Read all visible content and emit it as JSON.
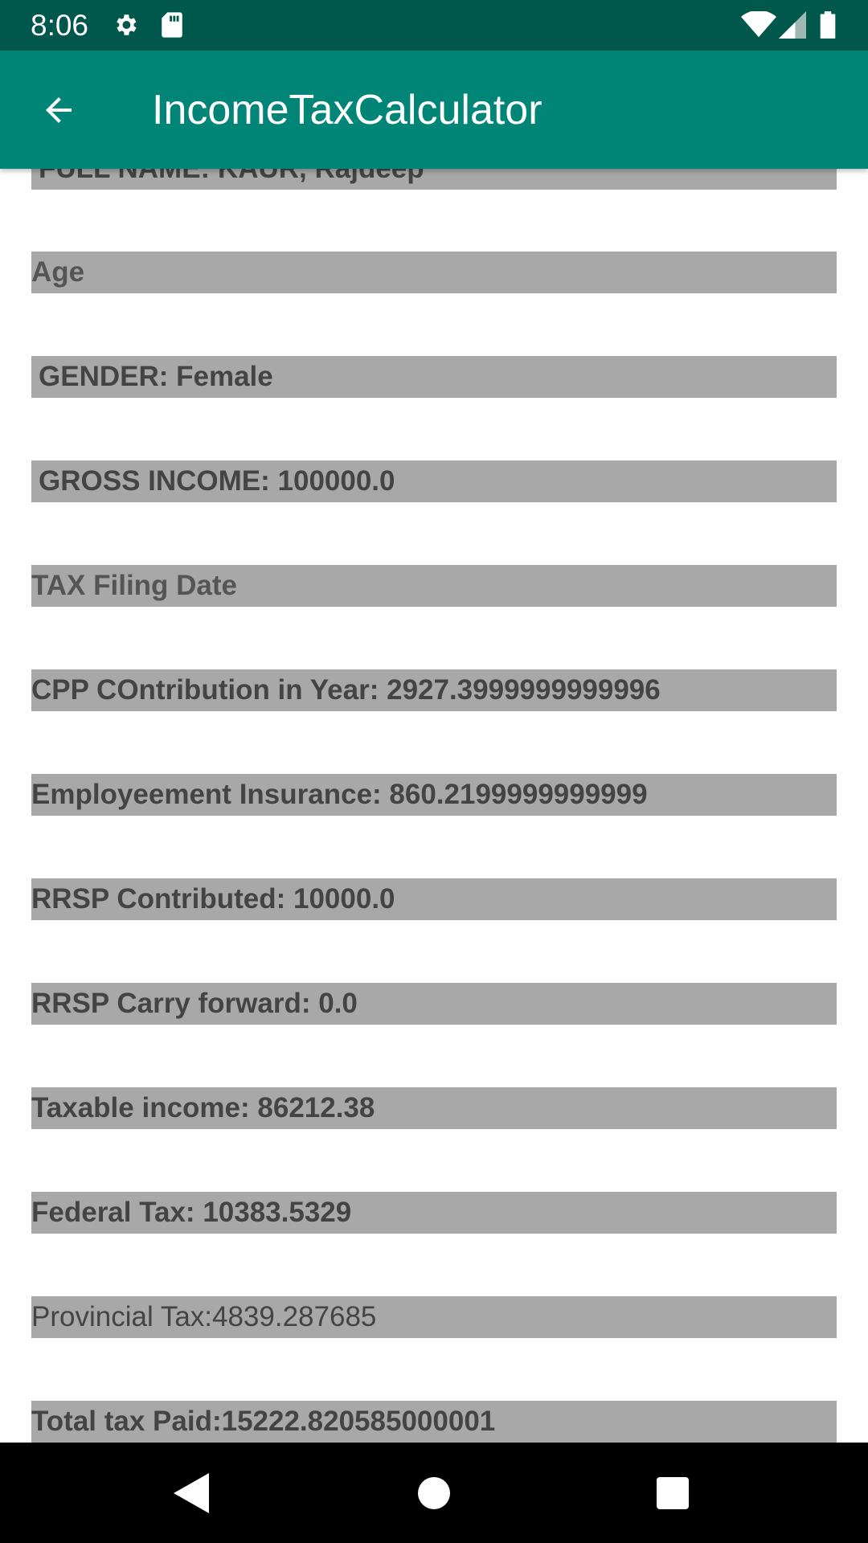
{
  "status_bar": {
    "time": "8:06",
    "icons": [
      "gear-icon",
      "sd-card-icon",
      "wifi-icon",
      "signal-icon",
      "battery-icon"
    ]
  },
  "app_bar": {
    "title": "IncomeTaxCalculator",
    "back_icon": "arrow-back-icon"
  },
  "fields": {
    "full_name": "FULL NAME:  KAUR, Rajdeep",
    "age": "Age",
    "gender": "GENDER:  Female",
    "gross_income": "GROSS INCOME: 100000.0",
    "tax_filing_date": "TAX Filing Date",
    "cpp_contribution": "CPP COntribution in Year: 2927.3999999999996",
    "employment_insurance": "Employeement Insurance:   860.2199999999999",
    "rrsp_contributed": "RRSP Contributed:   10000.0",
    "rrsp_carry_forward": "RRSP Carry forward:  0.0",
    "taxable_income": "Taxable income: 86212.38",
    "federal_tax": "Federal Tax:  10383.5329",
    "provincial_tax": "Provincial Tax:4839.287685",
    "total_tax_paid": "Total tax Paid:15222.820585000001"
  },
  "nav_bar": {
    "buttons": [
      "back-triangle-icon",
      "home-circle-icon",
      "recents-square-icon"
    ]
  },
  "colors": {
    "status_bar": "#00574b",
    "app_bar": "#008577",
    "field_background": "#a8a8a8",
    "field_text": "#444444"
  }
}
